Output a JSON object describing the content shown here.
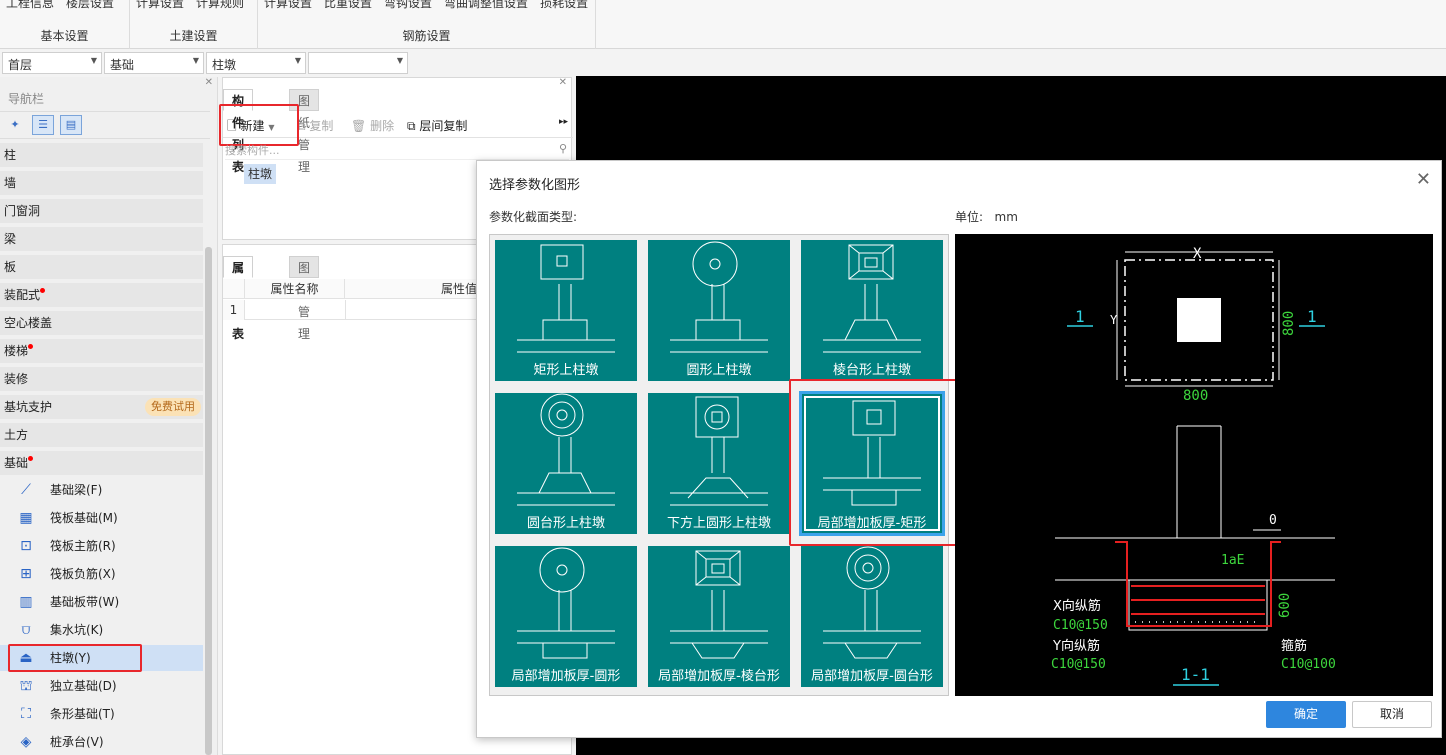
{
  "ribbon": {
    "groups": [
      {
        "title": "基本设置",
        "items": [
          "工程信息",
          "楼层设置"
        ]
      },
      {
        "title": "土建设置",
        "items": [
          "计算设置",
          "计算规则"
        ]
      },
      {
        "title": "钢筋设置",
        "items": [
          "计算设置",
          "比重设置",
          "弯钩设置",
          "弯曲调整值设置",
          "损耗设置"
        ]
      }
    ]
  },
  "combos": [
    "首层",
    "基础",
    "柱墩",
    ""
  ],
  "nav": {
    "title": "导航栏",
    "categories": [
      {
        "label": "柱",
        "dot": false
      },
      {
        "label": "墙",
        "dot": false
      },
      {
        "label": "门窗洞",
        "dot": false
      },
      {
        "label": "梁",
        "dot": false
      },
      {
        "label": "板",
        "dot": false
      },
      {
        "label": "装配式",
        "dot": true
      },
      {
        "label": "空心楼盖",
        "dot": false
      },
      {
        "label": "楼梯",
        "dot": true
      },
      {
        "label": "装修",
        "dot": false
      },
      {
        "label": "基坑支护",
        "dot": false,
        "badge": "免费试用"
      },
      {
        "label": "土方",
        "dot": false
      },
      {
        "label": "基础",
        "dot": true
      }
    ],
    "subitems": [
      {
        "label": "基础梁(F)",
        "icon": "beam-icon",
        "glyph": "⟋"
      },
      {
        "label": "筏板基础(M)",
        "icon": "raft-grid-icon",
        "glyph": "▦"
      },
      {
        "label": "筏板主筋(R)",
        "icon": "main-rebar-icon",
        "glyph": "⊡"
      },
      {
        "label": "筏板负筋(X)",
        "icon": "neg-rebar-icon",
        "glyph": "⊞"
      },
      {
        "label": "基础板带(W)",
        "icon": "slab-strip-icon",
        "glyph": "▥"
      },
      {
        "label": "集水坑(K)",
        "icon": "sump-icon",
        "glyph": "⩌"
      },
      {
        "label": "柱墩(Y)",
        "icon": "column-pier-icon",
        "glyph": "⏏"
      },
      {
        "label": "独立基础(D)",
        "icon": "isolated-footing-icon",
        "glyph": "⛫"
      },
      {
        "label": "条形基础(T)",
        "icon": "strip-footing-icon",
        "glyph": "⛶"
      },
      {
        "label": "桩承台(V)",
        "icon": "pile-cap-icon",
        "glyph": "◈"
      }
    ]
  },
  "complist": {
    "tabs": [
      "构件列表",
      "图纸管理"
    ],
    "new_label": "新建",
    "copy_label": "复制",
    "delete_label": "删除",
    "floor_copy_label": "层间复制",
    "search_placeholder": "搜索构件...",
    "item": "柱墩"
  },
  "proplist": {
    "tabs": [
      "属性列表",
      "图层管理"
    ],
    "col_name": "属性名称",
    "col_value": "属性值",
    "row1": "1"
  },
  "dialog": {
    "title": "选择参数化图形",
    "section_label": "参数化截面类型:",
    "unit_label": "单位:",
    "unit_value": "mm",
    "shapes": [
      "矩形上柱墩",
      "圆形上柱墩",
      "棱台形上柱墩",
      "圆台形上柱墩",
      "下方上圆形上柱墩",
      "局部增加板厚-矩形",
      "局部增加板厚-圆形",
      "局部增加板厚-棱台形",
      "局部增加板厚-圆台形"
    ],
    "selected_index": 5,
    "ok_label": "确定",
    "cancel_label": "取消",
    "preview": {
      "dim_x": "X",
      "dim_y": "Y",
      "dim_800_bottom": "800",
      "dim_800_right": "800",
      "section_mark_left": "1",
      "section_mark_right": "1",
      "dim_0": "0",
      "la_e": "1aE",
      "dim_600": "600",
      "x_rebar_label": "X向纵筋",
      "x_rebar_value": "C10@150",
      "y_rebar_label": "Y向纵筋",
      "y_rebar_value": "C10@150",
      "stirrup_label": "箍筋",
      "stirrup_value": "C10@100",
      "section_name": "1-1"
    }
  },
  "colors": {
    "teal": "#008080",
    "accent": "#2e86de",
    "highlight": "#e8272c"
  }
}
